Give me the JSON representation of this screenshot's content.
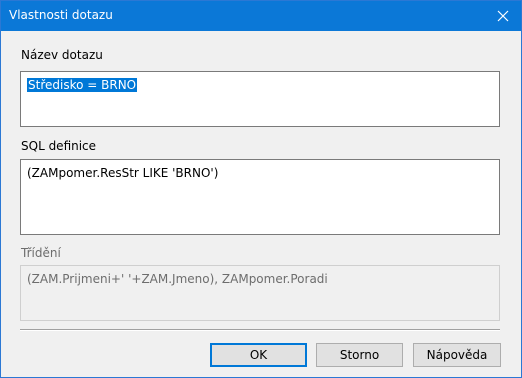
{
  "dialog": {
    "title": "Vlastnosti dotazu",
    "close_glyph": "✕"
  },
  "fields": {
    "name_label": "Název dotazu",
    "name_value": "Středisko = BRNO",
    "sql_label": "SQL definice",
    "sql_value": "(ZAMpomer.ResStr LIKE 'BRNO')",
    "sort_label": "Třídění",
    "sort_value": "(ZAM.Prijmeni+' '+ZAM.Jmeno), ZAMpomer.Poradi"
  },
  "buttons": {
    "ok": "OK",
    "cancel": "Storno",
    "help": "Nápověda"
  },
  "colors": {
    "titlebar": "#0b78d7",
    "selection": "#0078d7",
    "default_button_border": "#0078d7"
  },
  "icons": {
    "close": "close-icon"
  }
}
